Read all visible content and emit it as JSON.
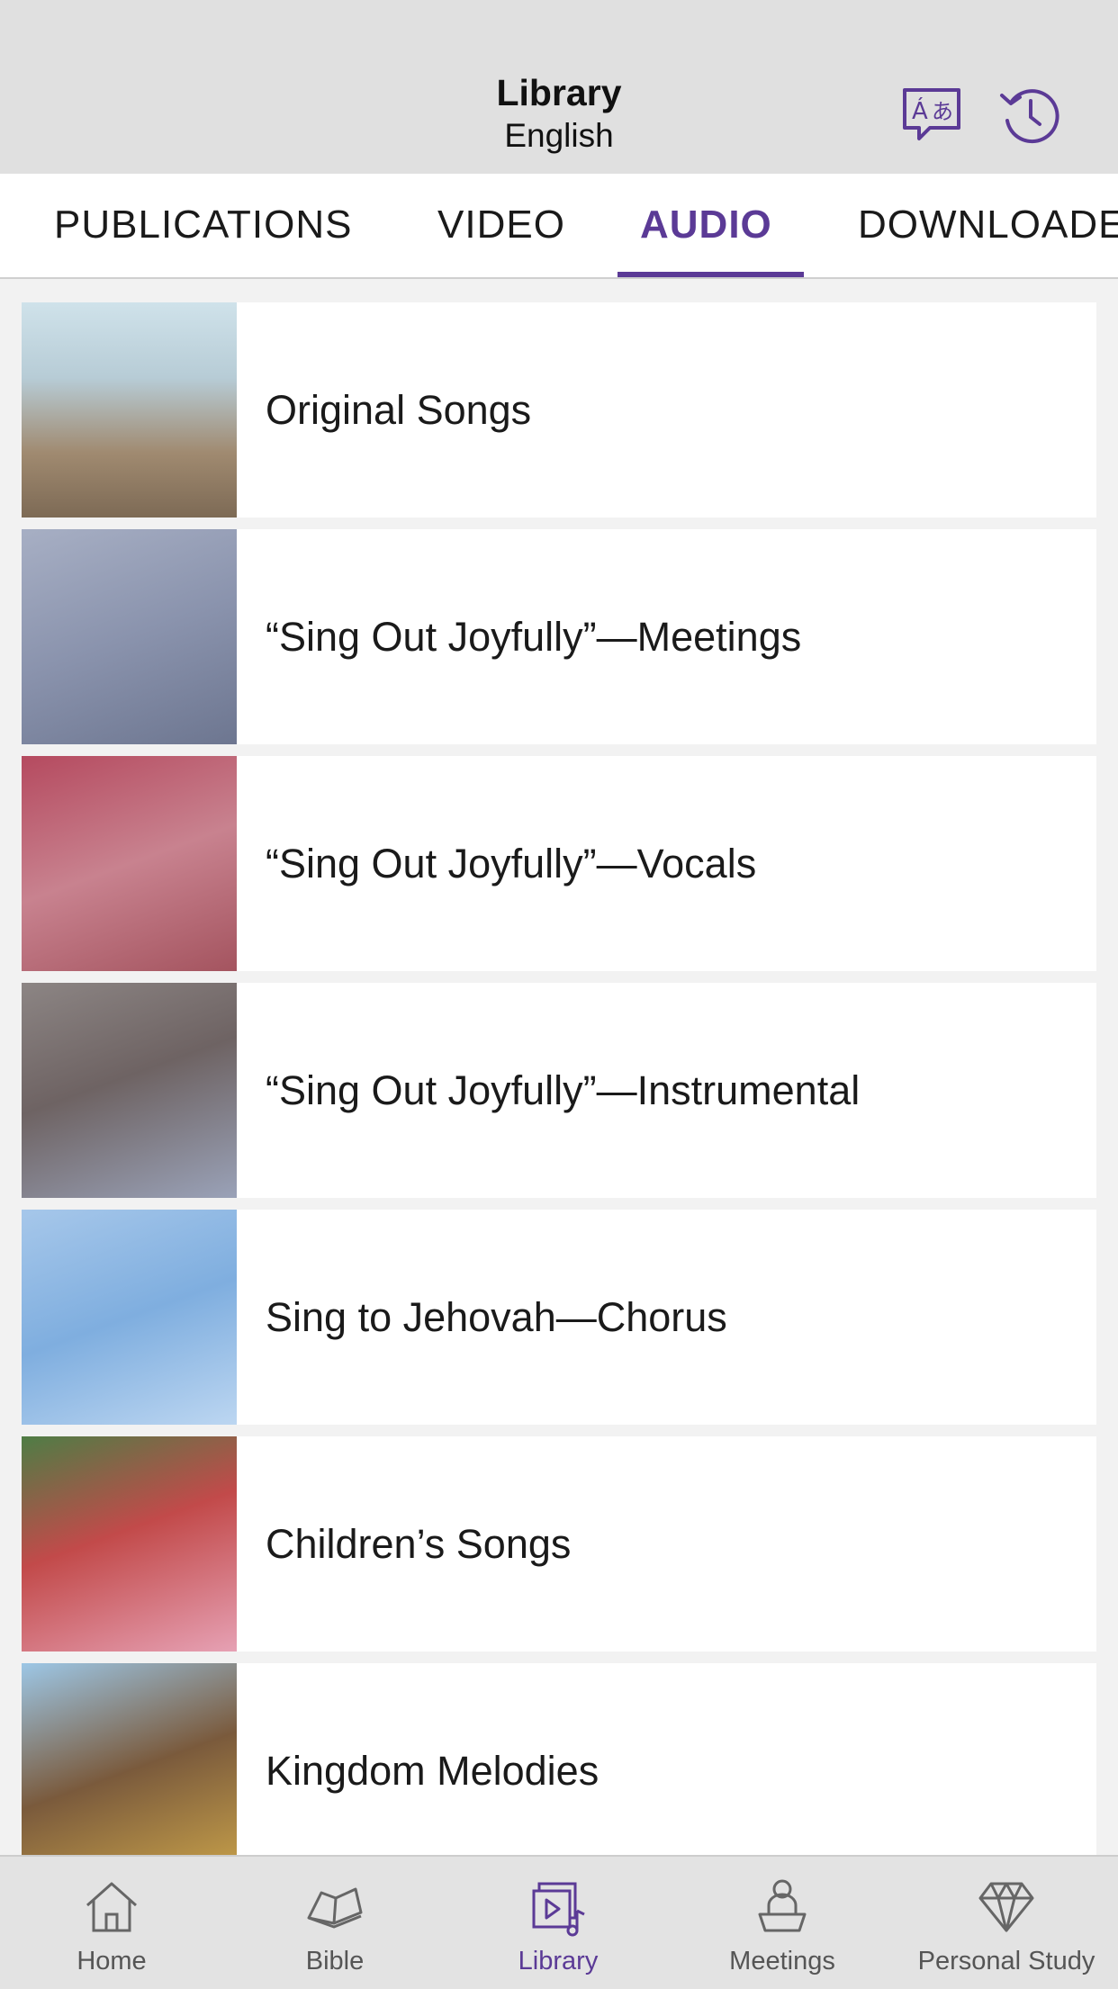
{
  "header": {
    "title": "Library",
    "subtitle": "English",
    "language_icon": "language-icon",
    "history_icon": "history-icon"
  },
  "tabs": [
    {
      "label": "PUBLICATIONS",
      "active": false
    },
    {
      "label": "VIDEO",
      "active": false
    },
    {
      "label": "AUDIO",
      "active": true
    },
    {
      "label": "DOWNLOADED",
      "active": false
    }
  ],
  "list": {
    "items": [
      {
        "label": "Original Songs"
      },
      {
        "label": "“Sing Out Joyfully”—Meetings"
      },
      {
        "label": "“Sing Out Joyfully”—Vocals"
      },
      {
        "label": "“Sing Out Joyfully”—Instrumental"
      },
      {
        "label": "Sing to Jehovah—Chorus"
      },
      {
        "label": "Children’s Songs"
      },
      {
        "label": "Kingdom Melodies"
      }
    ]
  },
  "bottom_nav": [
    {
      "label": "Home",
      "icon": "home-icon",
      "active": false
    },
    {
      "label": "Bible",
      "icon": "bible-icon",
      "active": false
    },
    {
      "label": "Library",
      "icon": "library-icon",
      "active": true
    },
    {
      "label": "Meetings",
      "icon": "meetings-icon",
      "active": false
    },
    {
      "label": "Personal Study",
      "icon": "personal-study-icon",
      "active": false
    }
  ],
  "colors": {
    "accent": "#5b3a96",
    "header_bg": "#e0e0e0",
    "list_bg": "#f2f2f2",
    "bottom_bar_bg": "#e3e3e3"
  }
}
